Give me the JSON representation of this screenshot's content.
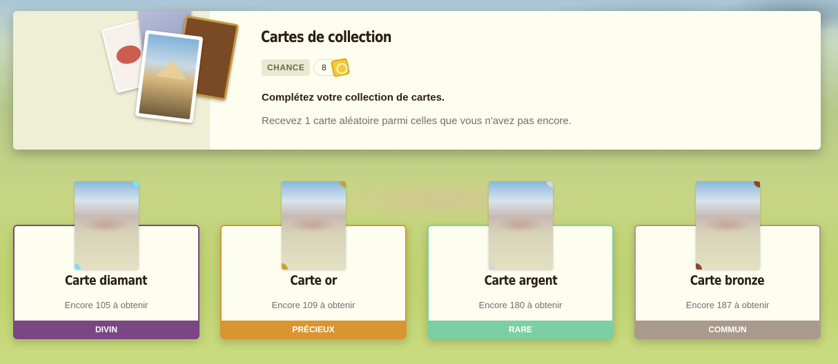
{
  "panel": {
    "title": "Cartes de collection",
    "chance_label": "CHANCE",
    "chance_value": "8",
    "subtitle": "Complétez votre collection de cartes.",
    "description": "Recevez 1 carte aléatoire parmi celles que vous n'avez pas encore."
  },
  "cards": [
    {
      "name": "Carte diamant",
      "count": "Encore 105 à obtenir",
      "rarity": "DIVIN",
      "color": "#7a4784",
      "corner": "#7fe0f0"
    },
    {
      "name": "Carte or",
      "count": "Encore 109 à obtenir",
      "rarity": "PRÉCIEUX",
      "color": "#d9952f",
      "corner": "#c9a137"
    },
    {
      "name": "Carte argent",
      "count": "Encore 180 à obtenir",
      "rarity": "RARE",
      "color": "#7ccfa3",
      "corner": "#d6d6d6"
    },
    {
      "name": "Carte bronze",
      "count": "Encore 187 à obtenir",
      "rarity": "COMMUN",
      "color": "#a89b8b",
      "corner": "#8a4a22"
    }
  ]
}
